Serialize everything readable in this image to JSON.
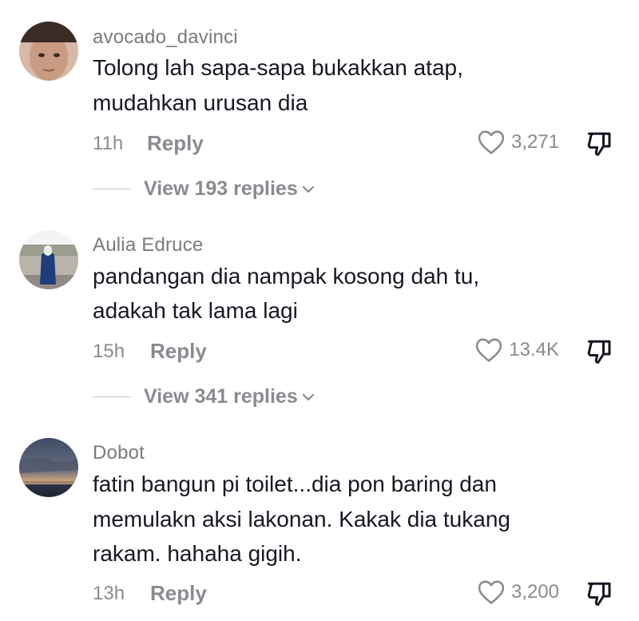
{
  "comments": [
    {
      "username": "avocado_davinci",
      "text_lines": [
        "Tolong lah sapa-sapa bukakkan atap,",
        "mudahkan urusan dia"
      ],
      "time": "11h",
      "reply_label": "Reply",
      "likes": "3,271",
      "view_replies": "View 193 replies"
    },
    {
      "username": "Aulia Edruce",
      "text_lines": [
        "pandangan dia nampak kosong dah tu,",
        "adakah tak lama lagi"
      ],
      "time": "15h",
      "reply_label": "Reply",
      "likes": "13.4K",
      "view_replies": "View 341 replies"
    },
    {
      "username": "Dobot",
      "text_lines": [
        "fatin bangun pi toilet...dia pon baring dan",
        "memulakn aksi lakonan. Kakak dia tukang",
        "rakam. hahaha gigih."
      ],
      "time": "13h",
      "reply_label": "Reply",
      "likes": "3,200"
    }
  ],
  "icons": {
    "like": "heart-outline-icon",
    "dislike": "thumbs-down-icon",
    "expand": "chevron-down-icon"
  },
  "colors": {
    "text": "#161823",
    "secondary": "#8a8b91",
    "username": "#7a7a80"
  }
}
